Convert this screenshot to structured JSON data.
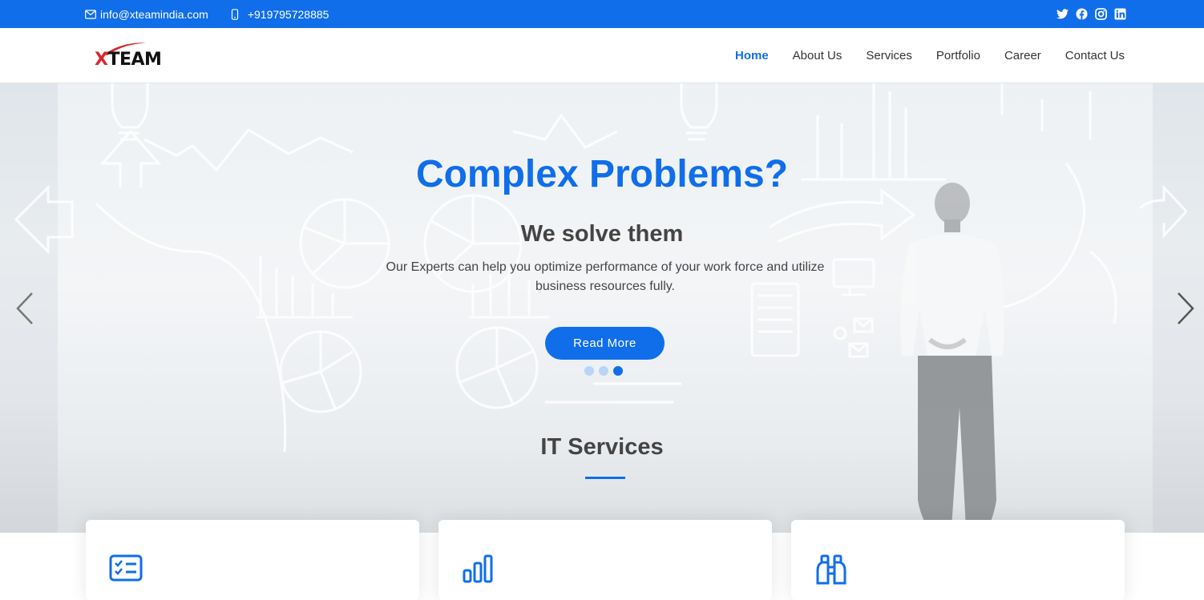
{
  "topbar": {
    "email": "info@xteamindia.com",
    "phone": "+919795728885",
    "social": [
      "twitter-icon",
      "facebook-icon",
      "instagram-icon",
      "linkedin-icon"
    ]
  },
  "brand": {
    "logo_x": "X",
    "logo_rest": "TEAM"
  },
  "nav": {
    "items": [
      "Home",
      "About Us",
      "Services",
      "Portfolio",
      "Career",
      "Contact Us"
    ],
    "active": "Home"
  },
  "hero": {
    "title": "Complex Problems?",
    "subtitle": "We solve them",
    "description": "Our Experts can help you optimize performance of your work force and utilize business resources fully.",
    "button": "Read More",
    "slides": 3,
    "active_slide": 3
  },
  "services": {
    "title": "IT Services",
    "cards": [
      {
        "icon": "checklist-icon"
      },
      {
        "icon": "bar-chart-icon"
      },
      {
        "icon": "binoculars-icon"
      }
    ]
  },
  "colors": {
    "accent": "#106eea",
    "text": "#444444",
    "logo_red": "#d6282e"
  }
}
